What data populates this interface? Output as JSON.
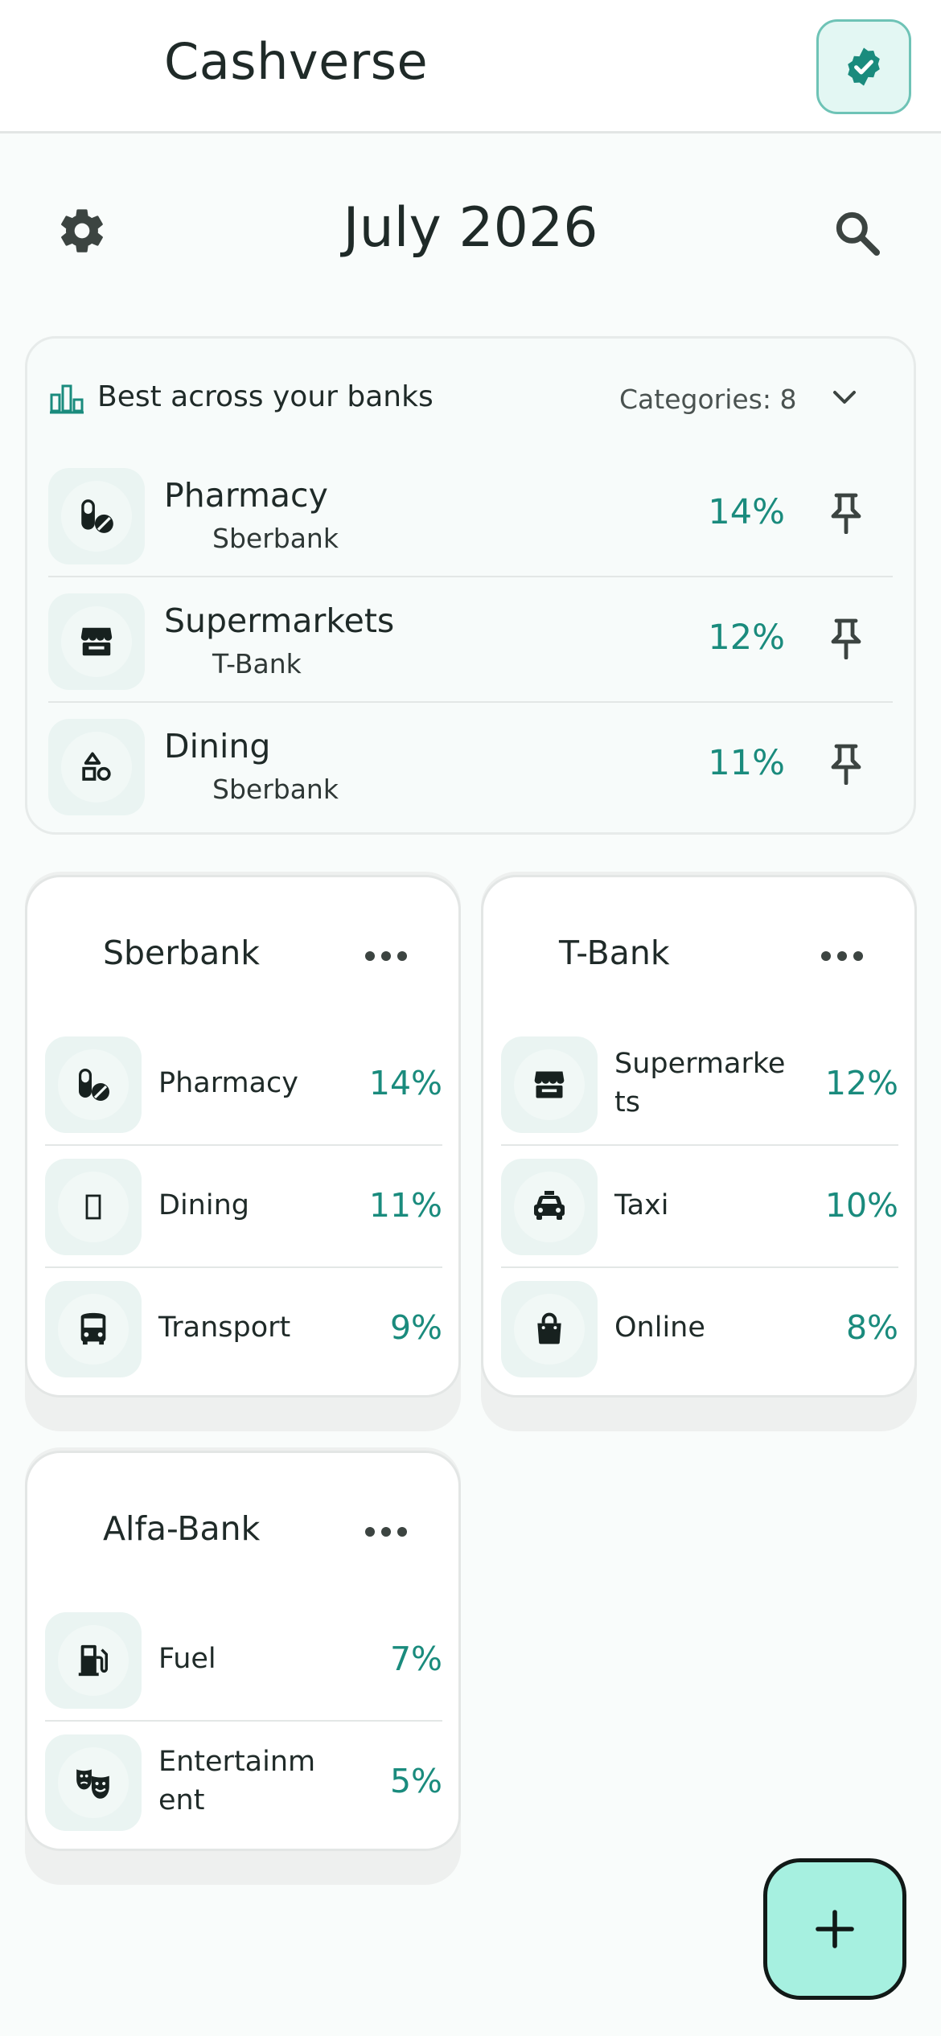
{
  "app": {
    "title": "Cashverse"
  },
  "header": {
    "month": "July 2026"
  },
  "best": {
    "title": "Best across your banks",
    "count_label": "Categories: 8",
    "rows": [
      {
        "category": "Pharmacy",
        "bank": "Sberbank",
        "percent": "14%",
        "icon": "pills-icon"
      },
      {
        "category": "Supermarkets",
        "bank": "T-Bank",
        "percent": "12%",
        "icon": "store-icon"
      },
      {
        "category": "Dining",
        "bank": "Sberbank",
        "percent": "11%",
        "icon": "shapes-icon"
      }
    ]
  },
  "banks": [
    {
      "name": "Sberbank",
      "items": [
        {
          "category": "Pharmacy",
          "percent": "14%",
          "icon": "pills-icon"
        },
        {
          "category": "Dining",
          "percent": "11%",
          "icon": "missing-glyph-icon"
        },
        {
          "category": "Transport",
          "percent": "9%",
          "icon": "bus-icon"
        }
      ]
    },
    {
      "name": "T-Bank",
      "items": [
        {
          "category": "Supermarkets",
          "percent": "12%",
          "icon": "store-icon"
        },
        {
          "category": "Taxi",
          "percent": "10%",
          "icon": "taxi-icon"
        },
        {
          "category": "Online",
          "percent": "8%",
          "icon": "shopping-bag-icon"
        }
      ]
    },
    {
      "name": "Alfa-Bank",
      "items": [
        {
          "category": "Fuel",
          "percent": "7%",
          "icon": "fuel-pump-icon"
        },
        {
          "category": "Entertainment",
          "percent": "5%",
          "icon": "theater-masks-icon"
        }
      ]
    }
  ],
  "colors": {
    "accent": "#1a8b7d",
    "fab": "#a6f0e0",
    "badge": "#1a8b7d"
  }
}
